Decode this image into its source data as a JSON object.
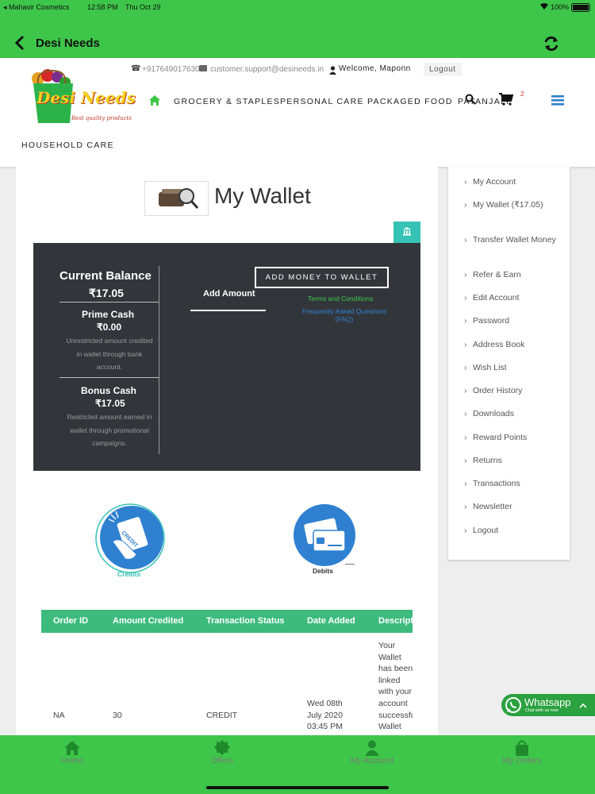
{
  "status": {
    "carrier": "◂ Mahavir Cosmetics",
    "time": "12:58 PM",
    "date": "Thu Oct 29",
    "battery": "100%"
  },
  "nav": {
    "title": "Desi Needs"
  },
  "header": {
    "phone": "+917649017630",
    "email": "customer.support@desineeds.in",
    "welcome": "Welcome, Maponn",
    "logout": "Logout",
    "logo_text": "Desi Needs",
    "logo_tagline": "Best quality products",
    "menu": [
      "GROCERY & STAPLES",
      "PERSONAL CARE",
      "PACKAGED FOOD",
      "PATANJALI",
      "HOUSEHOLD CARE"
    ],
    "cart_count": "2"
  },
  "wallet": {
    "title": "My Wallet",
    "current_balance_label": "Current Balance",
    "current_balance": "₹17.05",
    "prime_label": "Prime Cash",
    "prime_value": "₹0.00",
    "prime_desc": "Unrestricted amount credited in wallet through bank account.",
    "bonus_label": "Bonus Cash",
    "bonus_value": "₹17.05",
    "bonus_desc": "Restricted amount earned in wallet through promotional campaigns.",
    "add_amount_label": "Add Amount",
    "add_money_button": "ADD MONEY TO WALLET",
    "terms_link": "Terms and Conditions",
    "faq_link": "Frequently Asked Questions (FAQ)",
    "credits_label": "Credits",
    "credit_stamp": "CREDIT",
    "debits_label": "Debits"
  },
  "table": {
    "headers": [
      "Order ID",
      "Amount Credited",
      "Transaction Status",
      "Date Added",
      "Descript"
    ],
    "rows": [
      {
        "order_id": "NA",
        "amount": "30",
        "status": "CREDIT",
        "date": "Wed 08th July 2020 03:45 PM",
        "description": "Your Wallet has been linked with your account successfully Wallet Money Credited"
      }
    ]
  },
  "sidebar": {
    "items": [
      "My Account",
      "My Wallet (₹17.05)",
      "Transfer Wallet Money",
      "Refer & Earn",
      "Edit Account",
      "Password",
      "Address Book",
      "Wish List",
      "Order History",
      "Downloads",
      "Reward Points",
      "Returns",
      "Transactions",
      "Newsletter",
      "Logout"
    ]
  },
  "whatsapp": {
    "label": "Whatsapp",
    "sub": "Chat with us now"
  },
  "tabs": [
    "Home",
    "Offers",
    "My Account",
    "My Orders"
  ],
  "colors": {
    "green": "#3ec64a",
    "dark_panel": "#32363b",
    "teal": "#36c3b6",
    "table_green": "#3dbb7d",
    "blue_circle": "#2f80d0"
  }
}
